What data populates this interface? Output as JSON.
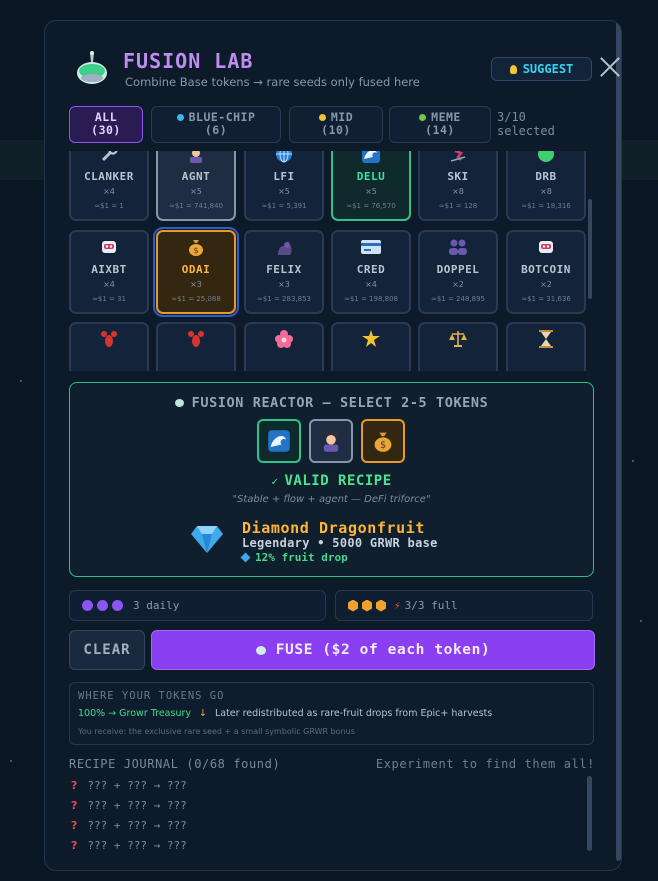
{
  "header": {
    "title": "FUSION LAB",
    "subtitle": "Combine Base tokens → rare seeds only fused here",
    "suggest_label": "SUGGEST"
  },
  "filters": [
    {
      "label": "ALL",
      "count": "(30)",
      "active": true
    },
    {
      "label": "BLUE-CHIP",
      "count": "(6)",
      "dot": "#3ab8f0"
    },
    {
      "label": "MID",
      "count": "(10)",
      "dot": "#f2c230"
    },
    {
      "label": "MEME",
      "count": "(14)",
      "dot": "#6cc84a"
    }
  ],
  "selected": {
    "line1": "3/10",
    "line2": "selected"
  },
  "tokens_row1": [
    {
      "name": "CLANKER",
      "qty": "×4",
      "price": "≈$1 = 1",
      "icon": "wrench-icon"
    },
    {
      "name": "AGNT",
      "qty": "×5",
      "price": "≈$1 = 741,840",
      "icon": "agent-icon",
      "state": "gray"
    },
    {
      "name": "LFI",
      "qty": "×5",
      "price": "≈$1 = 5,391",
      "icon": "globe-icon"
    },
    {
      "name": "DELU",
      "qty": "×5",
      "price": "≈$1 = 76,570",
      "icon": "wave-icon",
      "state": "green"
    },
    {
      "name": "SKI",
      "qty": "×8",
      "price": "≈$1 = 128",
      "icon": "skier-icon"
    },
    {
      "name": "DRB",
      "qty": "×8",
      "price": "≈$1 = 18,316",
      "icon": "green-orb-icon"
    }
  ],
  "tokens_row2": [
    {
      "name": "AIXBT",
      "qty": "×4",
      "price": "≈$1 = 31",
      "icon": "robot-icon"
    },
    {
      "name": "ODAI",
      "qty": "×3",
      "price": "≈$1 = 25,088",
      "icon": "money-bag-icon",
      "state": "orange"
    },
    {
      "name": "FELIX",
      "qty": "×3",
      "price": "≈$1 = 283,853",
      "icon": "cat-icon"
    },
    {
      "name": "CRED",
      "qty": "×4",
      "price": "≈$1 = 198,808",
      "icon": "card-icon"
    },
    {
      "name": "DOPPEL",
      "qty": "×2",
      "price": "≈$1 = 248,895",
      "icon": "people-icon"
    },
    {
      "name": "BOTCOIN",
      "qty": "×2",
      "price": "≈$1 = 31,636",
      "icon": "robot-icon"
    }
  ],
  "reactor": {
    "title": "FUSION REACTOR — SELECT 2-5 TOKENS",
    "status": "VALID RECIPE",
    "description": "\"Stable + flow + agent — DeFi triforce\"",
    "result_name": "Diamond Dragonfruit",
    "result_meta": "Legendary • 5000 GRWR base",
    "result_drop": "12% fruit drop"
  },
  "stats": {
    "daily": "3 daily",
    "full": "3/3 full"
  },
  "actions": {
    "clear": "CLEAR",
    "fuse": "FUSE ($2 of each token)"
  },
  "where": {
    "title": "WHERE YOUR TOKENS GO",
    "treasury": "100% → Growr Treasury",
    "redistribution": "Later redistributed as rare-fruit drops from Epic+ harvests",
    "note": "You receive: the exclusive rare seed + a small symbolic GRWR bonus"
  },
  "journal": {
    "title": "RECIPE JOURNAL (0/68 found)",
    "hint": "Experiment to find them all!",
    "rows": [
      "??? + ??? → ???",
      "??? + ??? → ???",
      "??? + ??? → ???",
      "??? + ??? → ???"
    ]
  },
  "colors": {
    "accent": "#8a3ff0",
    "valid": "#2fc27a",
    "gold": "#ffb53a"
  }
}
